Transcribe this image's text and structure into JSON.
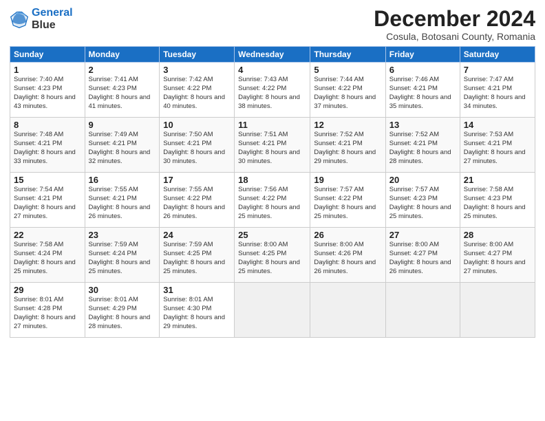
{
  "header": {
    "logo_line1": "General",
    "logo_line2": "Blue",
    "main_title": "December 2024",
    "subtitle": "Cosula, Botosani County, Romania"
  },
  "calendar": {
    "days_of_week": [
      "Sunday",
      "Monday",
      "Tuesday",
      "Wednesday",
      "Thursday",
      "Friday",
      "Saturday"
    ],
    "weeks": [
      [
        {
          "day": "",
          "empty": true
        },
        {
          "day": "",
          "empty": true
        },
        {
          "day": "",
          "empty": true
        },
        {
          "day": "",
          "empty": true
        },
        {
          "day": "",
          "empty": true
        },
        {
          "day": "",
          "empty": true
        },
        {
          "day": "",
          "empty": true
        }
      ],
      [
        {
          "day": "1",
          "sunrise": "7:40 AM",
          "sunset": "4:23 PM",
          "daylight": "8 hours and 43 minutes."
        },
        {
          "day": "2",
          "sunrise": "7:41 AM",
          "sunset": "4:23 PM",
          "daylight": "8 hours and 41 minutes."
        },
        {
          "day": "3",
          "sunrise": "7:42 AM",
          "sunset": "4:22 PM",
          "daylight": "8 hours and 40 minutes."
        },
        {
          "day": "4",
          "sunrise": "7:43 AM",
          "sunset": "4:22 PM",
          "daylight": "8 hours and 38 minutes."
        },
        {
          "day": "5",
          "sunrise": "7:44 AM",
          "sunset": "4:22 PM",
          "daylight": "8 hours and 37 minutes."
        },
        {
          "day": "6",
          "sunrise": "7:46 AM",
          "sunset": "4:21 PM",
          "daylight": "8 hours and 35 minutes."
        },
        {
          "day": "7",
          "sunrise": "7:47 AM",
          "sunset": "4:21 PM",
          "daylight": "8 hours and 34 minutes."
        }
      ],
      [
        {
          "day": "8",
          "sunrise": "7:48 AM",
          "sunset": "4:21 PM",
          "daylight": "8 hours and 33 minutes."
        },
        {
          "day": "9",
          "sunrise": "7:49 AM",
          "sunset": "4:21 PM",
          "daylight": "8 hours and 32 minutes."
        },
        {
          "day": "10",
          "sunrise": "7:50 AM",
          "sunset": "4:21 PM",
          "daylight": "8 hours and 30 minutes."
        },
        {
          "day": "11",
          "sunrise": "7:51 AM",
          "sunset": "4:21 PM",
          "daylight": "8 hours and 30 minutes."
        },
        {
          "day": "12",
          "sunrise": "7:52 AM",
          "sunset": "4:21 PM",
          "daylight": "8 hours and 29 minutes."
        },
        {
          "day": "13",
          "sunrise": "7:52 AM",
          "sunset": "4:21 PM",
          "daylight": "8 hours and 28 minutes."
        },
        {
          "day": "14",
          "sunrise": "7:53 AM",
          "sunset": "4:21 PM",
          "daylight": "8 hours and 27 minutes."
        }
      ],
      [
        {
          "day": "15",
          "sunrise": "7:54 AM",
          "sunset": "4:21 PM",
          "daylight": "8 hours and 27 minutes."
        },
        {
          "day": "16",
          "sunrise": "7:55 AM",
          "sunset": "4:21 PM",
          "daylight": "8 hours and 26 minutes."
        },
        {
          "day": "17",
          "sunrise": "7:55 AM",
          "sunset": "4:22 PM",
          "daylight": "8 hours and 26 minutes."
        },
        {
          "day": "18",
          "sunrise": "7:56 AM",
          "sunset": "4:22 PM",
          "daylight": "8 hours and 25 minutes."
        },
        {
          "day": "19",
          "sunrise": "7:57 AM",
          "sunset": "4:22 PM",
          "daylight": "8 hours and 25 minutes."
        },
        {
          "day": "20",
          "sunrise": "7:57 AM",
          "sunset": "4:23 PM",
          "daylight": "8 hours and 25 minutes."
        },
        {
          "day": "21",
          "sunrise": "7:58 AM",
          "sunset": "4:23 PM",
          "daylight": "8 hours and 25 minutes."
        }
      ],
      [
        {
          "day": "22",
          "sunrise": "7:58 AM",
          "sunset": "4:24 PM",
          "daylight": "8 hours and 25 minutes."
        },
        {
          "day": "23",
          "sunrise": "7:59 AM",
          "sunset": "4:24 PM",
          "daylight": "8 hours and 25 minutes."
        },
        {
          "day": "24",
          "sunrise": "7:59 AM",
          "sunset": "4:25 PM",
          "daylight": "8 hours and 25 minutes."
        },
        {
          "day": "25",
          "sunrise": "8:00 AM",
          "sunset": "4:25 PM",
          "daylight": "8 hours and 25 minutes."
        },
        {
          "day": "26",
          "sunrise": "8:00 AM",
          "sunset": "4:26 PM",
          "daylight": "8 hours and 26 minutes."
        },
        {
          "day": "27",
          "sunrise": "8:00 AM",
          "sunset": "4:27 PM",
          "daylight": "8 hours and 26 minutes."
        },
        {
          "day": "28",
          "sunrise": "8:00 AM",
          "sunset": "4:27 PM",
          "daylight": "8 hours and 27 minutes."
        }
      ],
      [
        {
          "day": "29",
          "sunrise": "8:01 AM",
          "sunset": "4:28 PM",
          "daylight": "8 hours and 27 minutes."
        },
        {
          "day": "30",
          "sunrise": "8:01 AM",
          "sunset": "4:29 PM",
          "daylight": "8 hours and 28 minutes."
        },
        {
          "day": "31",
          "sunrise": "8:01 AM",
          "sunset": "4:30 PM",
          "daylight": "8 hours and 29 minutes."
        },
        {
          "day": "",
          "empty": true
        },
        {
          "day": "",
          "empty": true
        },
        {
          "day": "",
          "empty": true
        },
        {
          "day": "",
          "empty": true
        }
      ]
    ]
  }
}
